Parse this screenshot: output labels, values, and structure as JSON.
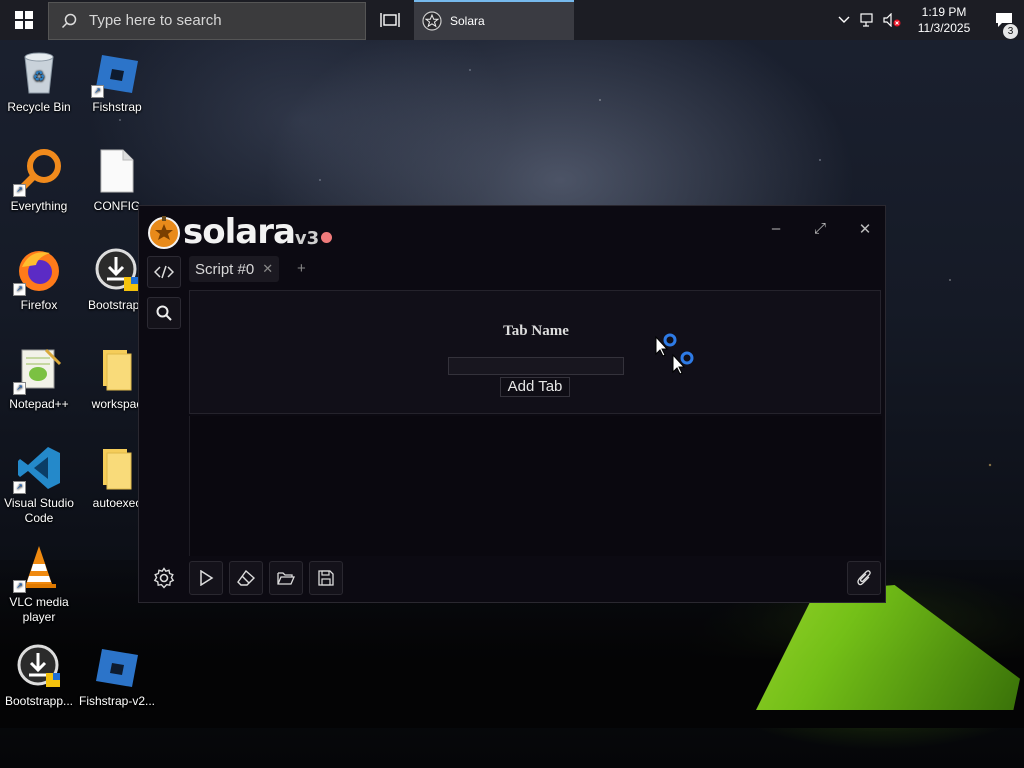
{
  "taskbar": {
    "search_placeholder": "Type here to search",
    "active_app": "Solara",
    "time": "1:19 PM",
    "date": "11/3/2025",
    "notification_count": "3"
  },
  "desktop_icons": [
    {
      "label": "Recycle Bin"
    },
    {
      "label": "Fishstrap"
    },
    {
      "label": "Everything"
    },
    {
      "label": "CONFIG"
    },
    {
      "label": "Firefox"
    },
    {
      "label": "Bootstrapp"
    },
    {
      "label": "Notepad++"
    },
    {
      "label": "workspac"
    },
    {
      "label": "Visual Studio Code"
    },
    {
      "label": "autoexec"
    },
    {
      "label": "VLC media player"
    },
    {
      "label": "Bootstrapp..."
    },
    {
      "label": "Fishstrap-v2..."
    }
  ],
  "solara": {
    "brand": "solara",
    "version": "v3",
    "tab_label": "Script #0",
    "add_tab_symbol": "+",
    "dialog_title": "Tab Name",
    "dialog_input_value": "",
    "dialog_button": "Add Tab",
    "window_controls": {
      "minimize": "–",
      "maximize": "⤢",
      "close": "✕"
    }
  },
  "colors": {
    "window_bg": "#0c0a12",
    "accent_dot": "#f07b7b",
    "taskbar_bg": "#1c1d24"
  },
  "icons": {
    "sidebar": [
      "code-icon",
      "search-icon"
    ],
    "bottom_bar": [
      "gear-icon",
      "play-icon",
      "eraser-icon",
      "folder-open-icon",
      "save-icon",
      "paperclip-icon"
    ]
  }
}
